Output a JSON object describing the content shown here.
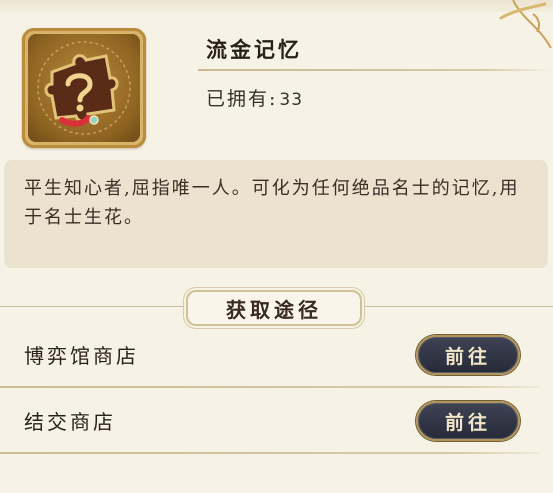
{
  "item": {
    "name": "流金记忆",
    "owned_label": "已拥有:",
    "owned_count": "33",
    "icon": "golden-puzzle-memory-icon",
    "description": "平生知心者,屈指唯一人。可化为任何绝品名士的记忆,用于名士生花。"
  },
  "sources": {
    "title": "获取途径",
    "shops": [
      {
        "label": "博弈馆商店",
        "button": "前往"
      },
      {
        "label": "结交商店",
        "button": "前往"
      }
    ]
  },
  "colors": {
    "background": "#f7f2e6",
    "button_fill": "#2e3242",
    "button_border": "#b29557",
    "button_text": "#f1e6c8",
    "desc_box": "#ebe3cf"
  }
}
